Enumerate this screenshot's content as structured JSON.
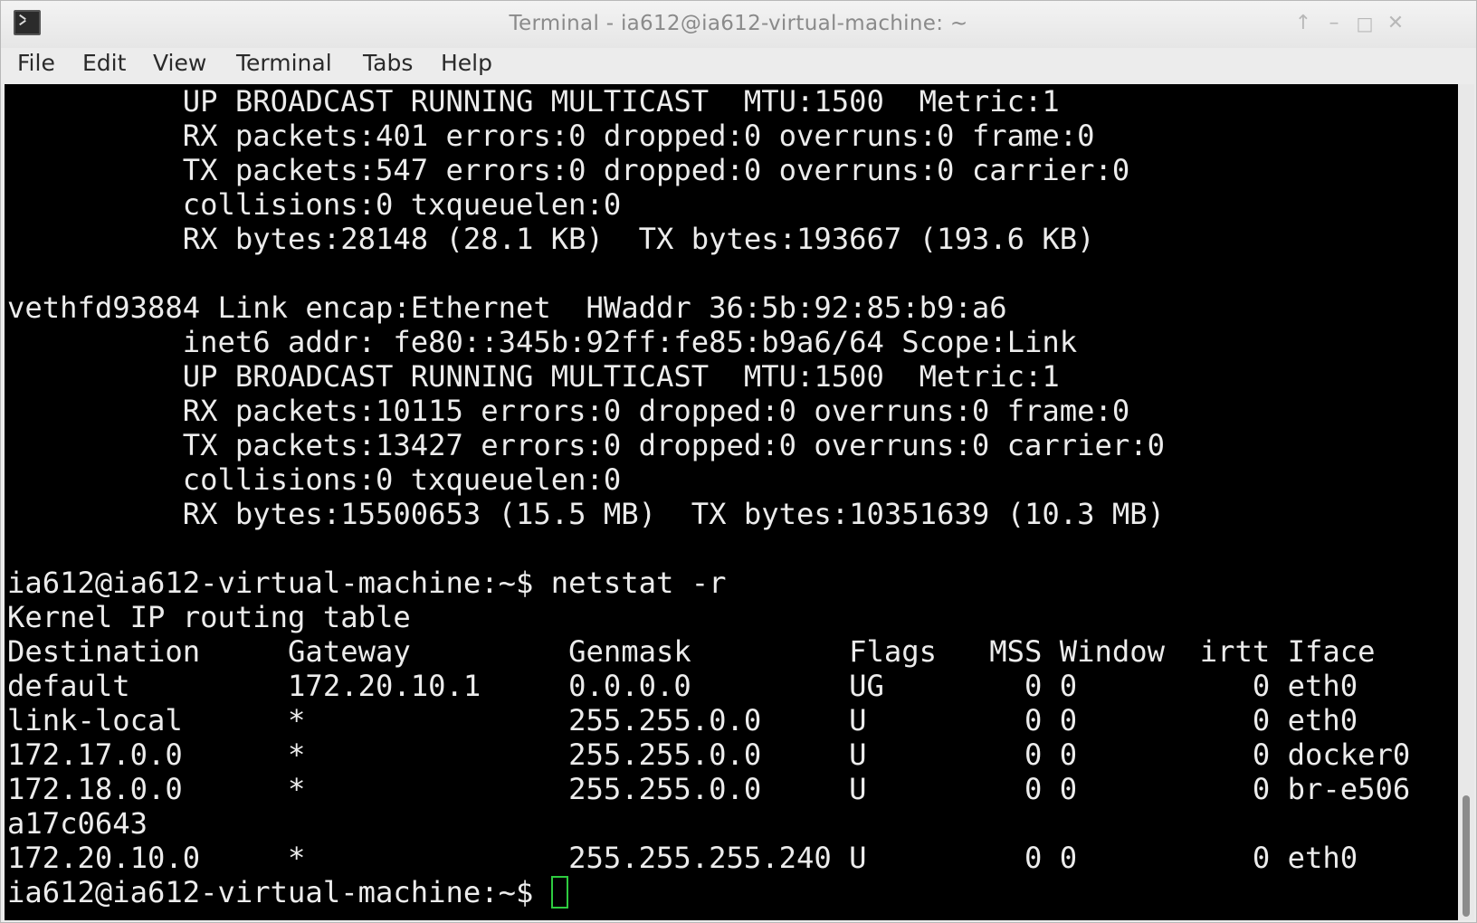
{
  "window": {
    "title": "Terminal - ia612@ia612-virtual-machine: ~"
  },
  "menu": [
    "File",
    "Edit",
    "View",
    "Terminal",
    "Tabs",
    "Help"
  ],
  "terminal": {
    "lines": [
      "          UP BROADCAST RUNNING MULTICAST  MTU:1500  Metric:1",
      "          RX packets:401 errors:0 dropped:0 overruns:0 frame:0",
      "          TX packets:547 errors:0 dropped:0 overruns:0 carrier:0",
      "          collisions:0 txqueuelen:0",
      "          RX bytes:28148 (28.1 KB)  TX bytes:193667 (193.6 KB)",
      "",
      "vethfd93884 Link encap:Ethernet  HWaddr 36:5b:92:85:b9:a6",
      "          inet6 addr: fe80::345b:92ff:fe85:b9a6/64 Scope:Link",
      "          UP BROADCAST RUNNING MULTICAST  MTU:1500  Metric:1",
      "          RX packets:10115 errors:0 dropped:0 overruns:0 frame:0",
      "          TX packets:13427 errors:0 dropped:0 overruns:0 carrier:0",
      "          collisions:0 txqueuelen:0",
      "          RX bytes:15500653 (15.5 MB)  TX bytes:10351639 (10.3 MB)",
      "",
      "ia612@ia612-virtual-machine:~$ netstat -r",
      "Kernel IP routing table",
      "Destination     Gateway         Genmask         Flags   MSS Window  irtt Iface",
      "default         172.20.10.1     0.0.0.0         UG        0 0          0 eth0",
      "link-local      *               255.255.0.0     U         0 0          0 eth0",
      "172.17.0.0      *               255.255.0.0     U         0 0          0 docker0",
      "172.18.0.0      *               255.255.0.0     U         0 0          0 br-e506",
      "a17c0643",
      "172.20.10.0     *               255.255.255.240 U         0 0          0 eth0"
    ],
    "prompt": "ia612@ia612-virtual-machine:~$ "
  },
  "icons": {
    "app": "terminal-icon",
    "scroll_up": "arrow-up-icon",
    "minimize": "minimize-icon",
    "maximize": "maximize-icon",
    "close": "close-icon"
  },
  "colors": {
    "terminal_bg": "#000000",
    "terminal_fg": "#ececec",
    "cursor": "#2ecc40"
  }
}
